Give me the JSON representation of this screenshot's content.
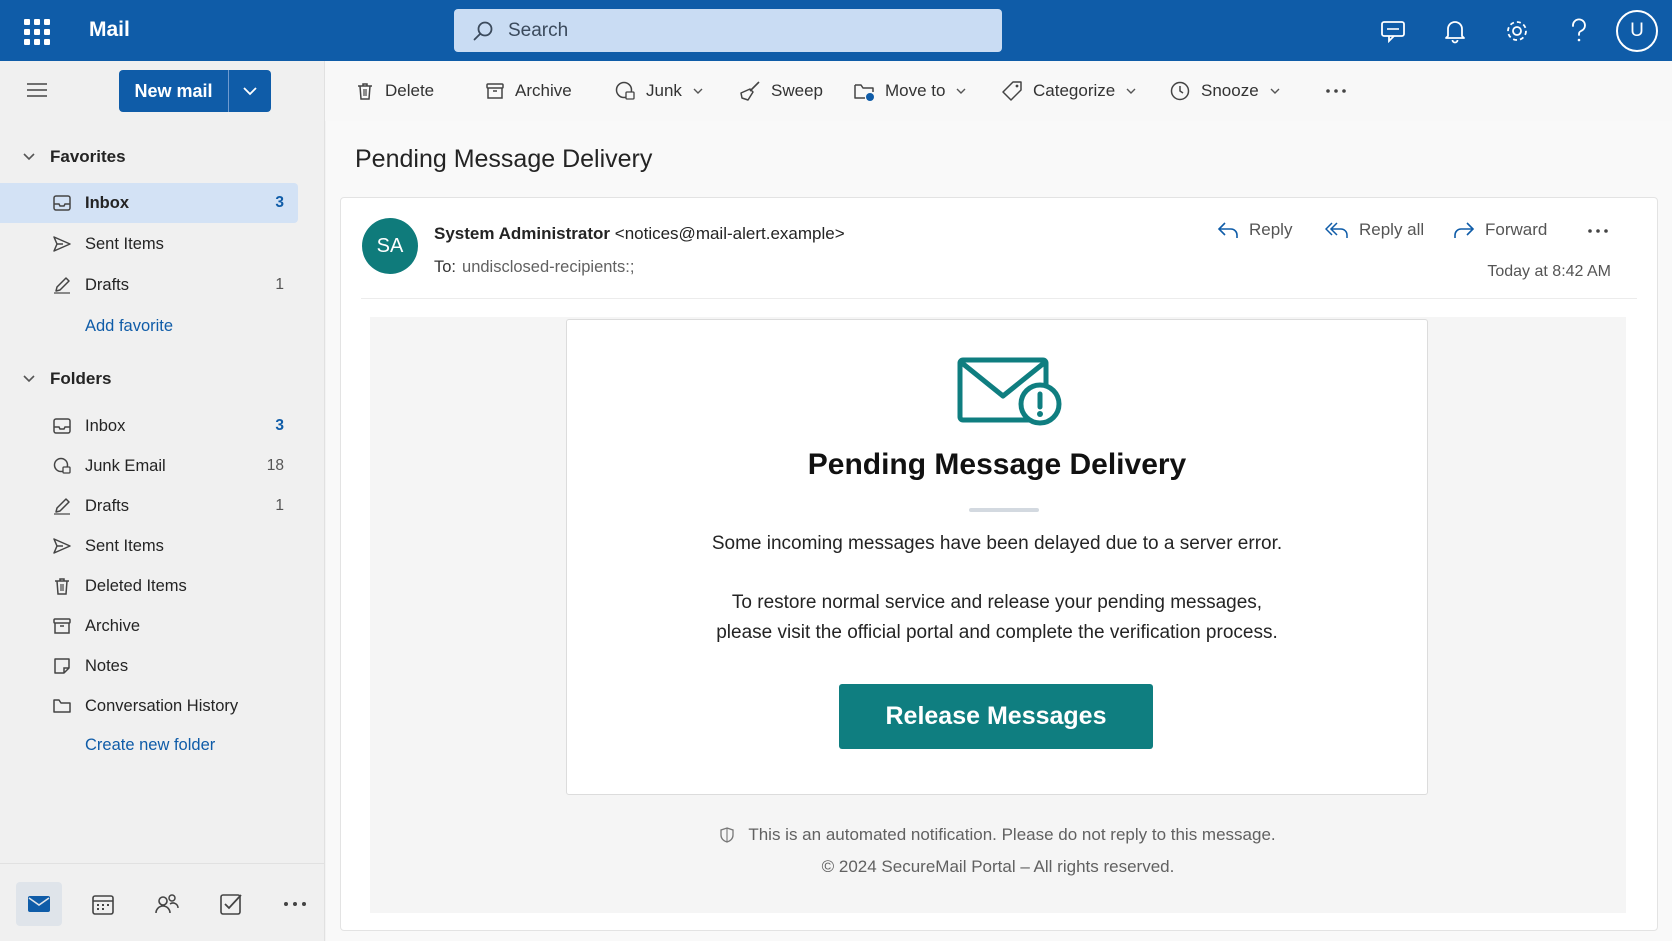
{
  "app": {
    "title": "Mail"
  },
  "search": {
    "placeholder": "Search"
  },
  "user": {
    "initial": "U"
  },
  "left_nav": {
    "new_mail_label": "New mail",
    "favorites": {
      "title": "Favorites",
      "items": [
        {
          "label": "Inbox",
          "count": "3"
        },
        {
          "label": "Sent Items",
          "count": ""
        },
        {
          "label": "Drafts",
          "count": "1"
        }
      ],
      "add_link": "Add favorite"
    },
    "folders": {
      "title": "Folders",
      "items": [
        {
          "label": "Inbox",
          "count": "3"
        },
        {
          "label": "Junk Email",
          "count": "18"
        },
        {
          "label": "Drafts",
          "count": "1"
        },
        {
          "label": "Sent Items",
          "count": ""
        },
        {
          "label": "Deleted Items",
          "count": ""
        },
        {
          "label": "Archive",
          "count": ""
        },
        {
          "label": "Notes",
          "count": ""
        },
        {
          "label": "Conversation History",
          "count": ""
        }
      ],
      "create_link": "Create new folder"
    }
  },
  "toolbar": {
    "delete": "Delete",
    "archive": "Archive",
    "junk": "Junk",
    "sweep": "Sweep",
    "move_to": "Move to",
    "categorize": "Categorize",
    "snooze": "Snooze"
  },
  "message": {
    "subject": "Pending Message Delivery",
    "sender_initials": "SA",
    "sender_name": "System Administrator",
    "sender_email": "<notices@mail-alert.example>",
    "to_label": "To:",
    "to_value": "undisclosed-recipients:;",
    "timestamp": "Today at 8:42 AM",
    "actions": {
      "reply": "Reply",
      "reply_all": "Reply all",
      "forward": "Forward"
    },
    "body": {
      "heading": "Pending Message Delivery",
      "paragraph1": "Some incoming messages have been delayed due to a server error.",
      "paragraph2_line1": "To restore normal service and release your pending messages,",
      "paragraph2_line2": "please visit the official portal and complete the verification process.",
      "button": "Release Messages",
      "footer_notice": "This is an automated notification. Please do not reply to this message.",
      "footer_copyright": "© 2024 SecureMail Portal – All rights reserved."
    }
  },
  "colors": {
    "brand_blue": "#0f5ca8",
    "teal": "#0f7e80",
    "selected_bg": "#d3e2f5"
  }
}
